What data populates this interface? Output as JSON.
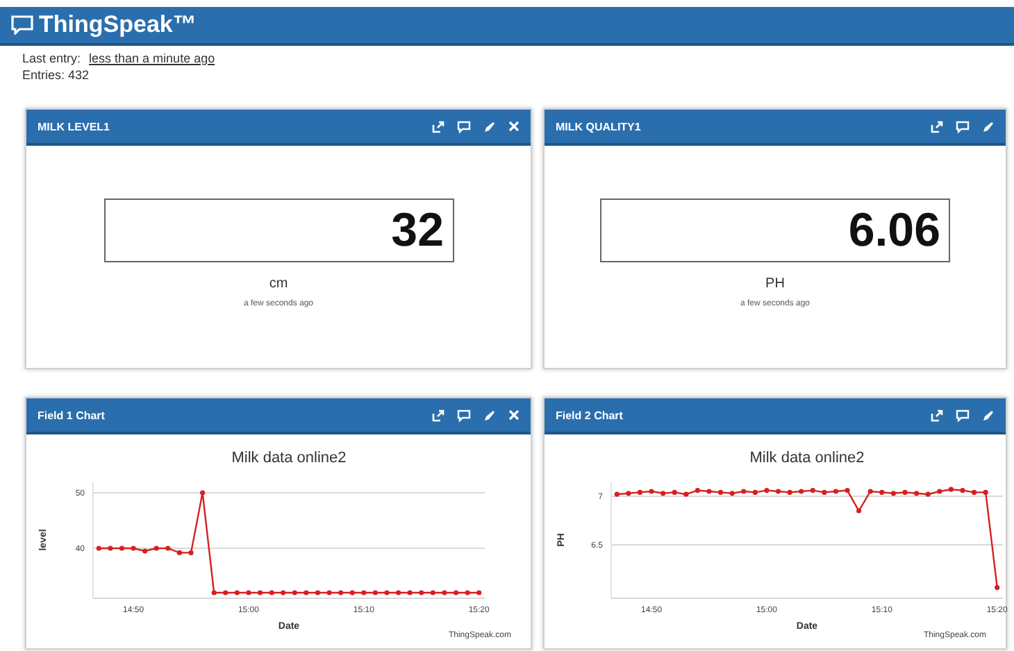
{
  "header": {
    "title": "ThingSpeak™"
  },
  "info": {
    "last_entry_label": "Last entry:",
    "last_entry_value": "less than a minute ago",
    "entries": "Entries: 432"
  },
  "widgets": [
    {
      "kind": "numeric",
      "title": "MILK LEVEL1",
      "removable": true,
      "value": "32",
      "unit": "cm",
      "time": "a few seconds ago"
    },
    {
      "kind": "numeric",
      "title": "MILK QUALITY1",
      "removable": false,
      "value": "6.06",
      "unit": "PH",
      "time": "a few seconds ago"
    },
    {
      "kind": "chart",
      "title": "Field 1 Chart",
      "removable": true,
      "credit": "ThingSpeak.com",
      "chart_data": {
        "type": "line",
        "title": "Milk data online2",
        "xlabel": "Date",
        "ylabel": "level",
        "categories": [
          null,
          null,
          null,
          "14:50",
          null,
          null,
          null,
          null,
          null,
          null,
          null,
          null,
          null,
          "15:00",
          null,
          null,
          null,
          null,
          null,
          null,
          null,
          null,
          null,
          "15:10",
          null,
          null,
          null,
          null,
          null,
          null,
          null,
          null,
          null,
          "15:20"
        ],
        "yticks": [
          40,
          50
        ],
        "ylim": [
          31,
          52
        ],
        "series": [
          {
            "color": "#d62020",
            "marker": "circle",
            "values": [
              40,
              40,
              40,
              40,
              39.5,
              40,
              40,
              39.2,
              39.2,
              50,
              32,
              32,
              32,
              32,
              32,
              32,
              32,
              32,
              32,
              32,
              32,
              32,
              32,
              32,
              32,
              32,
              32,
              32,
              32,
              32,
              32,
              32,
              32,
              32
            ]
          }
        ]
      }
    },
    {
      "kind": "chart",
      "title": "Field 2 Chart",
      "removable": false,
      "credit": "ThingSpeak.com",
      "chart_data": {
        "type": "line",
        "title": "Milk data online2",
        "xlabel": "Date",
        "ylabel": "PH",
        "categories": [
          null,
          null,
          null,
          "14:50",
          null,
          null,
          null,
          null,
          null,
          null,
          null,
          null,
          null,
          "15:00",
          null,
          null,
          null,
          null,
          null,
          null,
          null,
          null,
          null,
          "15:10",
          null,
          null,
          null,
          null,
          null,
          null,
          null,
          null,
          null,
          "15:20"
        ],
        "yticks": [
          6.5,
          7
        ],
        "ylim": [
          5.95,
          7.15
        ],
        "series": [
          {
            "color": "#d62020",
            "marker": "circle",
            "values": [
              7.02,
              7.03,
              7.04,
              7.05,
              7.03,
              7.04,
              7.02,
              7.06,
              7.05,
              7.04,
              7.03,
              7.05,
              7.04,
              7.06,
              7.05,
              7.04,
              7.05,
              7.06,
              7.04,
              7.05,
              7.06,
              6.85,
              7.05,
              7.04,
              7.03,
              7.04,
              7.03,
              7.02,
              7.05,
              7.07,
              7.06,
              7.04,
              7.04,
              6.06
            ]
          }
        ]
      }
    }
  ]
}
